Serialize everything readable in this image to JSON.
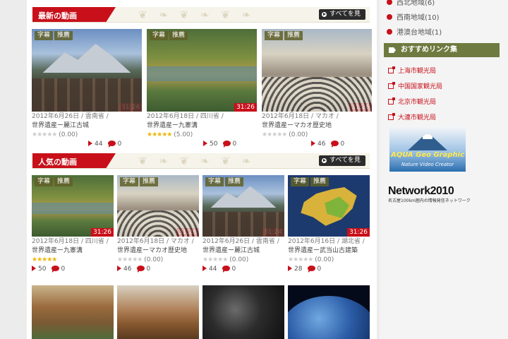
{
  "sections": {
    "latest": {
      "title": "最新の動画",
      "more": "すべてを見る"
    },
    "popular": {
      "title": "人気の動画",
      "more": "すべてを見る"
    }
  },
  "latest_videos": [
    {
      "badges": [
        "字幕",
        "推薦"
      ],
      "duration": "31:24",
      "date": "2012年6月26日",
      "region": "雲南省",
      "title": "世界遺産ー麗江古城",
      "rating": "(0.00)",
      "views": "44",
      "comments": "0"
    },
    {
      "badges": [
        "字幕",
        "推薦"
      ],
      "duration": "31:26",
      "date": "2012年6月18日",
      "region": "四川省",
      "title": "世界遺産ー九寨溝",
      "rating": "(5.00)",
      "views": "50",
      "comments": "0"
    },
    {
      "badges": [
        "字幕",
        "推薦"
      ],
      "duration": "31:26",
      "date": "2012年6月18日",
      "region": "マカオ",
      "title": "世界遺産ーマカオ歴史地",
      "rating": "(0.00)",
      "views": "46",
      "comments": "0"
    }
  ],
  "popular_videos": [
    {
      "badges": [
        "字幕",
        "推薦"
      ],
      "duration": "31:26",
      "date": "2012年6月18日",
      "region": "四川省",
      "title": "世界遺産ー九寨溝",
      "rating": "",
      "views": "50",
      "comments": "0"
    },
    {
      "badges": [
        "字幕",
        "推薦"
      ],
      "duration": "31:26",
      "date": "2012年6月18日",
      "region": "マカオ",
      "title": "世界遺産ーマカオ歴史地",
      "rating": "(0.00)",
      "views": "46",
      "comments": "0"
    },
    {
      "badges": [
        "字幕",
        "推薦"
      ],
      "duration": "31:24",
      "date": "2012年6月26日",
      "region": "雲南省",
      "title": "世界遺産ー麗江古城",
      "rating": "(0.00)",
      "views": "44",
      "comments": "0"
    },
    {
      "badges": [
        "字幕",
        "推薦"
      ],
      "duration": "31:26",
      "date": "2012年6月16日",
      "region": "湖北省",
      "title": "世界遺産ー武当山古建築",
      "rating": "(0.00)",
      "views": "28",
      "comments": "0"
    }
  ],
  "latest_stars": [
    0,
    5,
    0
  ],
  "popular_stars": [
    5,
    0,
    0,
    0
  ],
  "sidebar": {
    "regions": [
      "西北地域(6)",
      "西南地域(10)",
      "港澳台地域(1)"
    ],
    "links_title": "おすすめリンク集",
    "links": [
      "上海市観光局",
      "中国国家観光局",
      "北京市観光局",
      "大連市観光局"
    ],
    "banner1_title": "AQUA Geo Graphic",
    "banner1_sub": "Nature Video Creator",
    "banner2_title": "Network2010",
    "banner2_sub": "名古屋100km圏内の情報発信ネットワーク"
  },
  "colors": {
    "accent": "#c8101a",
    "olive": "#6e7a3f",
    "gold": "#f0b400"
  }
}
